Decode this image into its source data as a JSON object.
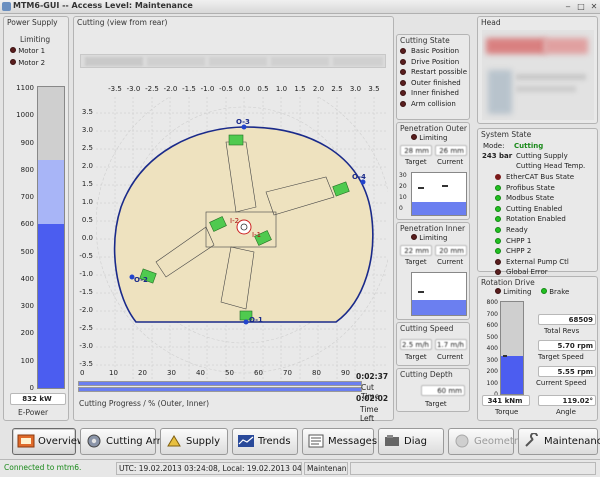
{
  "window": {
    "title": "MTM6-GUI -- Access Level: Maintenance"
  },
  "power_supply": {
    "title": "Power Supply",
    "limiting_label": "Limiting",
    "motors": [
      "Motor 1",
      "Motor 2"
    ],
    "scale": [
      "1100",
      "1000",
      "900",
      "800",
      "700",
      "600",
      "500",
      "400",
      "300",
      "200",
      "100",
      "0"
    ],
    "value": "832 kW",
    "caption": "E-Power"
  },
  "cutting": {
    "title": "Cutting (view from rear)",
    "x_ticks": [
      "-3.5",
      "-3.0",
      "-2.5",
      "-2.0",
      "-1.5",
      "-1.0",
      "-0.5",
      "0.0",
      "0.5",
      "1.0",
      "1.5",
      "2.0",
      "2.5",
      "3.0",
      "3.5"
    ],
    "y_ticks": [
      "3.5",
      "3.0",
      "2.5",
      "2.0",
      "1.5",
      "1.0",
      "0.5",
      "0.0",
      "-0.5",
      "-1.0",
      "-1.5",
      "-2.0",
      "-2.5",
      "-3.0",
      "-3.5"
    ],
    "arm_labels": [
      "O-3",
      "O-4",
      "O-2",
      "O-1",
      "I-2",
      "I-1"
    ],
    "progress_ticks": [
      "0",
      "10",
      "20",
      "30",
      "40",
      "50",
      "60",
      "70",
      "80",
      "90"
    ],
    "progress_caption": "Cutting Progress / % (Outer, Inner)",
    "cut_time_value": "0:02:37",
    "cut_time_label": "Cut Time",
    "time_left_value": "0:02:02",
    "time_left_label": "Time Left"
  },
  "cutting_state": {
    "title": "Cutting State",
    "items": [
      "Basic Position",
      "Drive Position",
      "Restart possible",
      "Outer finished",
      "Inner finished",
      "Arm collision"
    ]
  },
  "penetration_outer": {
    "title": "Penetration Outer",
    "limiting_label": "Limiting",
    "target_value": "28 mm",
    "current_value": "26 mm",
    "target_label": "Target",
    "current_label": "Current",
    "scale": [
      "30",
      "20",
      "10",
      "0"
    ]
  },
  "penetration_inner": {
    "title": "Penetration Inner",
    "limiting_label": "Limiting",
    "target_value": "22 mm",
    "current_value": "20 mm",
    "target_label": "Target",
    "current_label": "Current"
  },
  "cutting_speed": {
    "title": "Cutting Speed",
    "target_value": "2.5 m/h",
    "current_value": "1.7 m/h",
    "target_label": "Target",
    "current_label": "Current"
  },
  "cutting_depth": {
    "title": "Cutting Depth",
    "value": "60 mm",
    "target_label": "Target"
  },
  "head": {
    "title": "Head"
  },
  "system_state": {
    "title": "System State",
    "mode_label": "Mode:",
    "mode_value": "Cutting",
    "pressure": "243 bar",
    "lines": [
      "Cutting Supply",
      "Cutting Head Temp."
    ],
    "items": [
      "EtherCAT Bus State",
      "Profibus State",
      "Modbus State",
      "Cutting Enabled",
      "Rotation Enabled",
      "Ready",
      "CHPP 1",
      "CHPP 2",
      "External Pump Ctl",
      "Global Error"
    ],
    "item_colors": [
      "red",
      "green",
      "green",
      "green",
      "green",
      "green",
      "green",
      "green",
      "dark",
      "dark"
    ]
  },
  "rotation_drive": {
    "title": "Rotation Drive",
    "limiting_label": "Limiting",
    "brake_label": "Brake",
    "scale": [
      "800",
      "700",
      "600",
      "500",
      "400",
      "300",
      "200",
      "100",
      "0"
    ],
    "total_revs_value": "68509",
    "total_revs_label": "Total Revs",
    "target_speed_value": "5.70 rpm",
    "target_speed_label": "Target Speed",
    "current_speed_value": "5.55 rpm",
    "current_speed_label": "Current Speed",
    "torque_value": "341 kNm",
    "torque_label": "Torque",
    "angle_value": "119.02°",
    "angle_label": "Angle"
  },
  "nav": {
    "buttons": [
      "Overview",
      "Cutting Arms",
      "Supply",
      "Trends",
      "Messages",
      "Diag",
      "Geometry",
      "Maintenance"
    ]
  },
  "statusbar": {
    "connection": "Connected to mtm6.",
    "time": "UTC: 19.02.2013 03:24:08, Local: 19.02.2013 04:24:08",
    "level": "Maintenance"
  },
  "chart_data": {
    "type": "bar",
    "title": "E-Power",
    "categories": [
      "E-Power"
    ],
    "values": [
      832
    ],
    "ylim": [
      0,
      1100
    ]
  }
}
